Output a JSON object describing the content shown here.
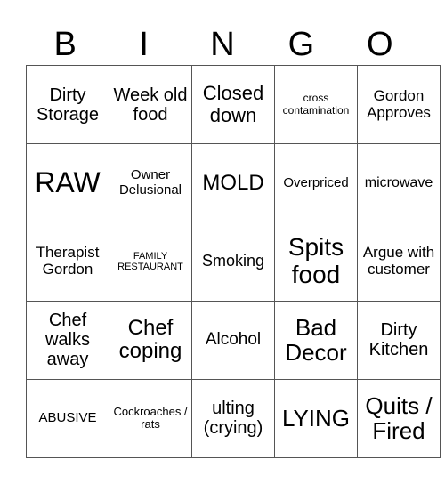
{
  "header": {
    "letters": [
      "B",
      "I",
      "N",
      "G",
      "O"
    ]
  },
  "grid": {
    "rows": [
      [
        "Dirty Storage",
        "Week old food",
        "Closed down",
        "cross contamination",
        "Gordon Approves"
      ],
      [
        "RAW",
        "Owner Delusional",
        "MOLD",
        "Overpriced",
        "microwave"
      ],
      [
        "Therapist Gordon",
        "FAMILY RESTAURANT",
        "Smoking",
        "Spits food",
        "Argue with customer"
      ],
      [
        "Chef walks away",
        "Chef coping",
        "Alcohol",
        "Bad Decor",
        "Dirty Kitchen"
      ],
      [
        "ABUSIVE",
        "Cockroaches / rats",
        "ulting (crying)",
        "LYING",
        "Quits / Fired"
      ]
    ]
  }
}
